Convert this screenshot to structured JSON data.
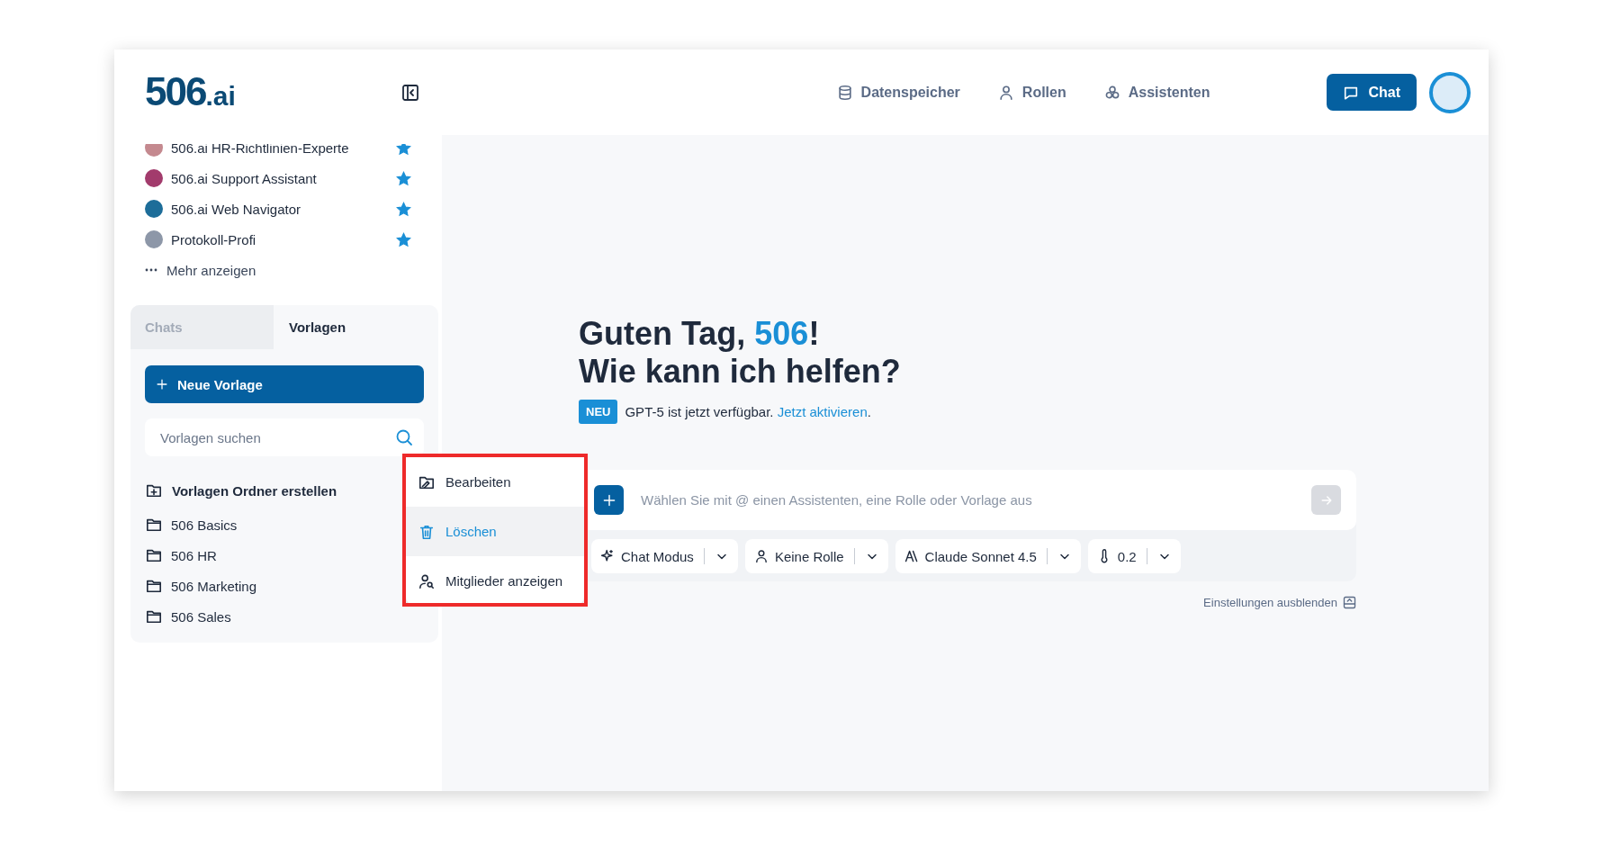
{
  "header": {
    "logo": {
      "main": "506",
      "suffix": ".ai"
    },
    "nav": [
      {
        "label": "Datenspeicher",
        "kind": "storage"
      },
      {
        "label": "Rollen",
        "kind": "role"
      },
      {
        "label": "Assistenten",
        "kind": "assistants"
      }
    ],
    "chat_button": "Chat"
  },
  "sidebar": {
    "assistants": [
      {
        "name": "506.ai HR-Richtlinien-Experte",
        "color": "#c4898f",
        "starred": true
      },
      {
        "name": "506.ai Support Assistant",
        "color": "#a23b6c",
        "starred": true
      },
      {
        "name": "506.ai Web Navigator",
        "color": "#1d6d99",
        "starred": true
      },
      {
        "name": "Protokoll-Profi",
        "color": "#8d97a8",
        "starred": true
      }
    ],
    "more": "Mehr anzeigen",
    "tabs": [
      {
        "label": "Chats",
        "selected": false
      },
      {
        "label": "Vorlagen",
        "selected": true
      }
    ],
    "new_button": "Neue Vorlage",
    "search": {
      "placeholder": "Vorlagen suchen"
    },
    "create_folder": "Vorlagen Ordner erstellen",
    "folders": [
      "506 Basics",
      "506 HR",
      "506 Marketing",
      "506 Sales"
    ]
  },
  "context_menu": {
    "highlighted": true,
    "items": [
      {
        "label": "Bearbeiten",
        "kind": "edit",
        "selected": false
      },
      {
        "label": "Löschen",
        "kind": "delete",
        "selected": true
      },
      {
        "label": "Mitglieder anzeigen",
        "kind": "members",
        "selected": false
      }
    ]
  },
  "main": {
    "greeting": {
      "prefix": "Guten Tag, ",
      "name": "506",
      "suffix": "!"
    },
    "question": "Wie kann ich helfen?",
    "announcement": {
      "badge": "NEU",
      "text": "GPT-5 ist jetzt verfügbar. ",
      "link": "Jetzt aktivieren",
      "end": "."
    },
    "composer": {
      "placeholder": "Wählen Sie mit @ einen Assistenten, eine Rolle oder Vorlage aus",
      "send_disabled": true
    },
    "settings": [
      {
        "label": "Chat Modus",
        "kind": "mode"
      },
      {
        "label": "Keine Rolle",
        "kind": "role"
      },
      {
        "label": "Claude Sonnet 4.5",
        "kind": "model"
      },
      {
        "label": "0.2",
        "kind": "temperature"
      }
    ],
    "hide_settings": "Einstellungen ausblenden"
  }
}
